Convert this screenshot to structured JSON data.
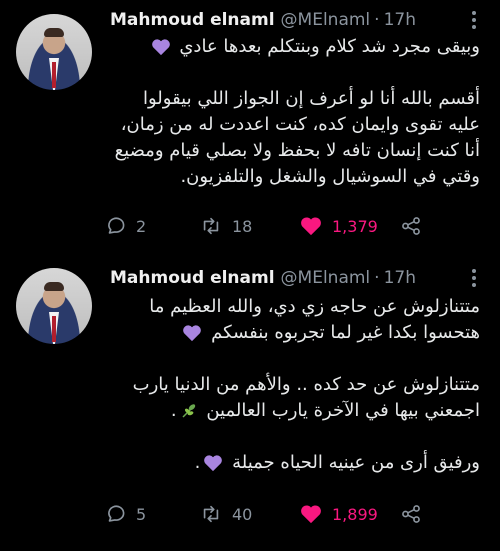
{
  "tweets": [
    {
      "author": {
        "name": "Mahmoud elnaml",
        "handle": "@MElnaml",
        "time": "17h"
      },
      "paragraphs": [
        "وبيقى مجرد شد كلام وبنتكلم بعدها عادي",
        "أقسم بالله أنا لو أعرف إن الجواز اللي بيقولوا عليه تقوى وايمان كده، كنت اعددت له من زمان، أنا كنت إنسان تافه لا بحفظ ولا بصلي قيام ومضيع وقتي في السوشيال والشغل والتلفزيون."
      ],
      "stats": {
        "replies": "2",
        "retweets": "18",
        "likes": "1,379"
      }
    },
    {
      "author": {
        "name": "Mahmoud elnaml",
        "handle": "@MElnaml",
        "time": "17h"
      },
      "paragraphs": [
        "متتنازلوش عن حاجه زي دي، والله العظيم ما هتحسوا بكدا غير لما تجربوه بنفسكم",
        "متتنازلوش عن حد كده .. والأهم من الدنيا يارب اجمعني بيها في الآخرة يارب العالمين",
        "ورفيق أرى من عينيه الحياه جميلة"
      ],
      "stats": {
        "replies": "5",
        "retweets": "40",
        "likes": "1,899"
      }
    }
  ],
  "colors": {
    "background": "#000000",
    "text": "#e7e9ea",
    "muted": "#8b949e",
    "like": "#f91880",
    "purple_heart": "#a985e0"
  },
  "icons": [
    "reply-icon",
    "retweet-icon",
    "like-icon",
    "share-icon",
    "more-icon",
    "purple-heart-emoji",
    "herb-emoji"
  ]
}
